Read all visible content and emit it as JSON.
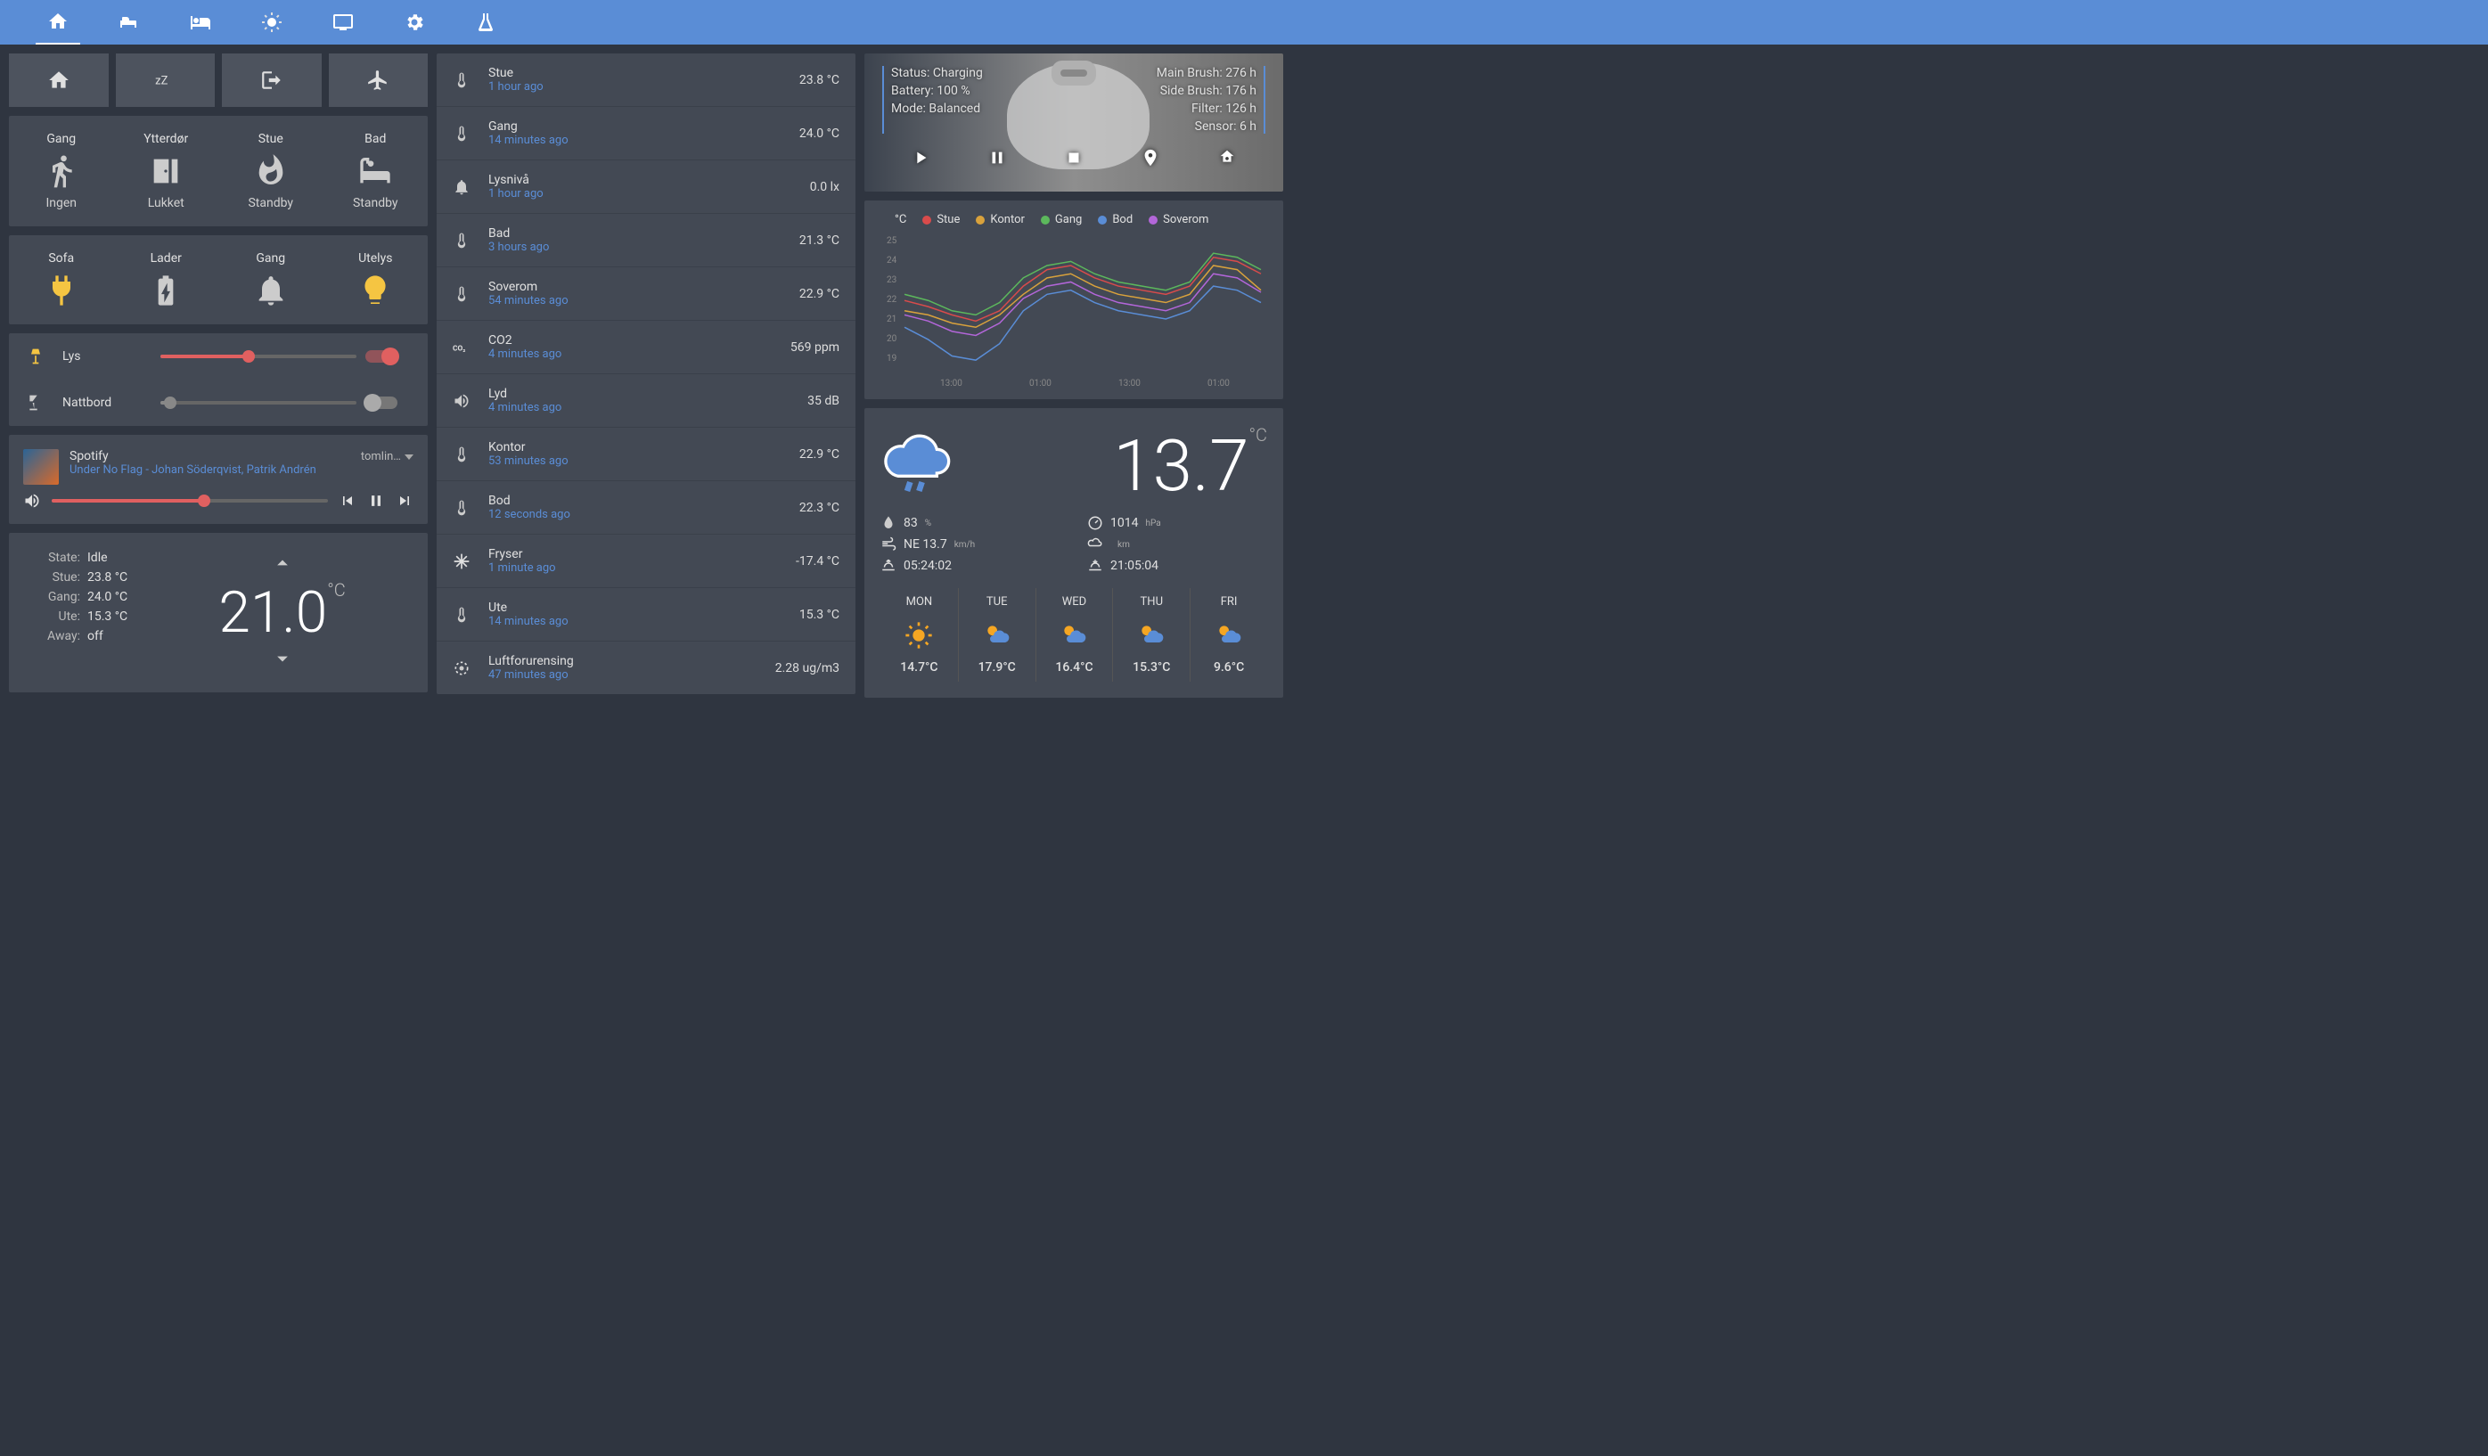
{
  "scenes": [
    "home",
    "sleep",
    "leave",
    "away"
  ],
  "tiles1": [
    {
      "name": "Gang",
      "state": "Ingen"
    },
    {
      "name": "Ytterdør",
      "state": "Lukket"
    },
    {
      "name": "Stue",
      "state": "Standby"
    },
    {
      "name": "Bad",
      "state": "Standby"
    }
  ],
  "tiles2": [
    {
      "name": "Sofa",
      "state": ""
    },
    {
      "name": "Lader",
      "state": ""
    },
    {
      "name": "Gang",
      "state": ""
    },
    {
      "name": "Utelys",
      "state": ""
    }
  ],
  "lights": [
    {
      "name": "Lys",
      "on": true,
      "level": 45
    },
    {
      "name": "Nattbord",
      "on": false,
      "level": 5
    }
  ],
  "media": {
    "title": "Spotify",
    "track": "Under No Flag - Johan Söderqvist, Patrik Andrén",
    "source": "tomlin…",
    "volume": 55
  },
  "climate": {
    "state_lbl": "State:",
    "state": "Idle",
    "stue_lbl": "Stue:",
    "stue": "23.8 °C",
    "gang_lbl": "Gang:",
    "gang": "24.0 °C",
    "ute_lbl": "Ute:",
    "ute": "15.3 °C",
    "away_lbl": "Away:",
    "away": "off",
    "target": "21.0",
    "unit": "°C"
  },
  "sensors": [
    {
      "icon": "therm",
      "name": "Stue",
      "time": "1 hour ago",
      "val": "23.8 °C"
    },
    {
      "icon": "therm",
      "name": "Gang",
      "time": "14 minutes ago",
      "val": "24.0 °C"
    },
    {
      "icon": "bell",
      "name": "Lysnivå",
      "time": "1 hour ago",
      "val": "0.0 lx"
    },
    {
      "icon": "therm",
      "name": "Bad",
      "time": "3 hours ago",
      "val": "21.3 °C"
    },
    {
      "icon": "therm",
      "name": "Soverom",
      "time": "54 minutes ago",
      "val": "22.9 °C"
    },
    {
      "icon": "co2",
      "name": "CO2",
      "time": "4 minutes ago",
      "val": "569 ppm"
    },
    {
      "icon": "vol",
      "name": "Lyd",
      "time": "4 minutes ago",
      "val": "35 dB"
    },
    {
      "icon": "therm",
      "name": "Kontor",
      "time": "53 minutes ago",
      "val": "22.9 °C"
    },
    {
      "icon": "therm",
      "name": "Bod",
      "time": "12 seconds ago",
      "val": "22.3 °C"
    },
    {
      "icon": "snow",
      "name": "Fryser",
      "time": "1 minute ago",
      "val": "-17.4 °C"
    },
    {
      "icon": "therm",
      "name": "Ute",
      "time": "14 minutes ago",
      "val": "15.3 °C"
    },
    {
      "icon": "target",
      "name": "Luftforurensing",
      "time": "47 minutes ago",
      "val": "2.28 ug/m3"
    }
  ],
  "vacuum": {
    "status_lbl": "Status: Charging",
    "battery_lbl": "Battery: 100 %",
    "mode_lbl": "Mode: Balanced",
    "main_lbl": "Main Brush: 276 h",
    "side_lbl": "Side Brush: 176 h",
    "filter_lbl": "Filter: 126 h",
    "sensor_lbl": "Sensor: 6 h"
  },
  "chart": {
    "ylabel": "°C",
    "series": [
      "Stue",
      "Kontor",
      "Gang",
      "Bod",
      "Soverom"
    ],
    "colors": [
      "#d94b4b",
      "#d9a23c",
      "#5cb85c",
      "#5a8dd6",
      "#b366d9"
    ],
    "yticks": [
      "25",
      "24",
      "23",
      "22",
      "21",
      "20",
      "19"
    ],
    "xticks": [
      "13:00",
      "01:00",
      "13:00",
      "01:00"
    ]
  },
  "chart_data": {
    "type": "line",
    "ylabel": "°C",
    "ylim": [
      19,
      25.5
    ],
    "x": [
      "13:00",
      "01:00",
      "13:00",
      "01:00"
    ],
    "series": [
      {
        "name": "Stue",
        "color": "#d94b4b",
        "values": [
          22.5,
          22.2,
          21.8,
          21.5,
          22.0,
          23.2,
          24.0,
          24.2,
          23.6,
          23.2,
          23.0,
          22.8,
          23.2,
          24.6,
          24.4,
          23.8
        ]
      },
      {
        "name": "Kontor",
        "color": "#d9a23c",
        "values": [
          22.0,
          21.8,
          21.4,
          21.2,
          21.8,
          22.8,
          23.6,
          23.8,
          23.2,
          22.8,
          22.6,
          22.4,
          22.8,
          24.2,
          24.0,
          23.0
        ]
      },
      {
        "name": "Gang",
        "color": "#5cb85c",
        "values": [
          22.8,
          22.5,
          22.0,
          21.8,
          22.4,
          23.6,
          24.2,
          24.4,
          23.8,
          23.4,
          23.2,
          23.0,
          23.4,
          24.8,
          24.6,
          24.0
        ]
      },
      {
        "name": "Bod",
        "color": "#5a8dd6",
        "values": [
          21.2,
          20.6,
          19.8,
          19.6,
          20.4,
          22.0,
          22.8,
          23.0,
          22.4,
          22.0,
          21.8,
          21.6,
          22.0,
          23.2,
          23.0,
          22.4
        ]
      },
      {
        "name": "Soverom",
        "color": "#b366d9",
        "values": [
          21.8,
          21.5,
          21.0,
          20.8,
          21.4,
          22.6,
          23.2,
          23.4,
          22.8,
          22.4,
          22.2,
          22.0,
          22.4,
          23.8,
          23.6,
          22.9
        ]
      }
    ]
  },
  "weather": {
    "temp": "13.7",
    "unit": "°C",
    "humidity": "83",
    "humidity_u": "%",
    "pressure": "1014",
    "pressure_u": "hPa",
    "wind": "NE 13.7",
    "wind_u": "km/h",
    "vis": "",
    "vis_u": "km",
    "sunrise": "05:24:02",
    "sunset": "21:05:04",
    "forecast": [
      {
        "day": "MON",
        "temp": "14.7°C",
        "icon": "sun"
      },
      {
        "day": "TUE",
        "temp": "17.9°C",
        "icon": "part"
      },
      {
        "day": "WED",
        "temp": "16.4°C",
        "icon": "part"
      },
      {
        "day": "THU",
        "temp": "15.3°C",
        "icon": "part"
      },
      {
        "day": "FRI",
        "temp": "9.6°C",
        "icon": "part"
      }
    ]
  }
}
